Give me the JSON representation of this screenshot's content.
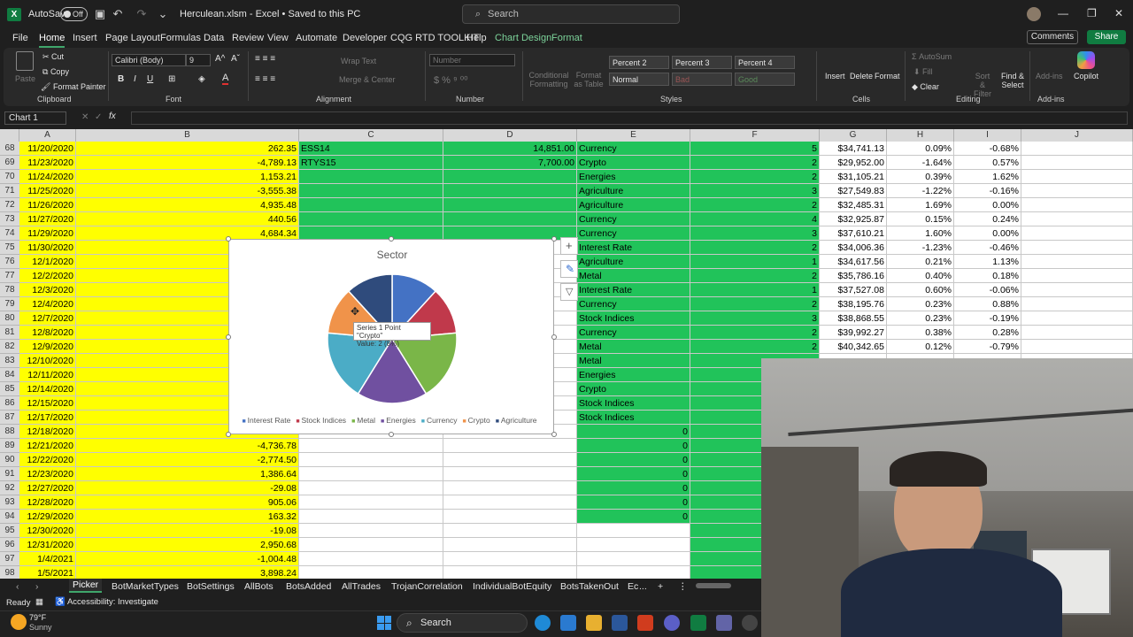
{
  "titlebar": {
    "autosave_label": "AutoSave",
    "autosave_state": "Off",
    "file_title": "Herculean.xlsm  -  Excel  •  Saved to this PC",
    "search_placeholder": "Search"
  },
  "menu": {
    "items": [
      "File",
      "Home",
      "Insert",
      "Page Layout",
      "Formulas",
      "Data",
      "Review",
      "View",
      "Automate",
      "Developer",
      "CQG RTD TOOLKIT",
      "Help",
      "Chart Design",
      "Format"
    ],
    "comments": "Comments",
    "share": "Share"
  },
  "ribbon": {
    "paste": "Paste",
    "cut": "Cut",
    "copy": "Copy",
    "format_painter": "Format Painter",
    "clipboard": "Clipboard",
    "font_name": "Calibri (Body)",
    "font_size": "9",
    "font_group": "Font",
    "wrap_text": "Wrap Text",
    "merge_center": "Merge & Center",
    "alignment": "Alignment",
    "number_format": "Number",
    "number_group": "Number",
    "conditional": "Conditional Formatting",
    "format_as_table": "Format as Table",
    "styles": [
      "Percent 2",
      "Percent 3",
      "Percent 4",
      "Normal",
      "Bad",
      "Good"
    ],
    "styles_group": "Styles",
    "insert": "Insert",
    "delete": "Delete",
    "format": "Format",
    "cells": "Cells",
    "autosum": "AutoSum",
    "fill": "Fill",
    "clear": "Clear",
    "sort_filter": "Sort & Filter",
    "find_select": "Find & Select",
    "editing": "Editing",
    "addins": "Add-ins",
    "addins_group": "Add-ins",
    "copilot": "Copilot"
  },
  "formula_bar": {
    "name_box": "Chart 1",
    "fx": "fx",
    "content": ""
  },
  "columns": [
    "A",
    "B",
    "C",
    "D",
    "E",
    "F",
    "G",
    "H",
    "I",
    "J"
  ],
  "rows": [
    {
      "n": "68",
      "a": "11/20/2020",
      "b": "262.35",
      "c": "ESS14",
      "d": "14,851.00",
      "e": "Currency",
      "f": "5",
      "g": "$34,741.13",
      "h": "0.09%",
      "i": "-0.68%"
    },
    {
      "n": "69",
      "a": "11/23/2020",
      "b": "-4,789.13",
      "c": "RTYS15",
      "d": "7,700.00",
      "e": "Crypto",
      "f": "2",
      "g": "$29,952.00",
      "h": "-1.64%",
      "i": "0.57%"
    },
    {
      "n": "70",
      "a": "11/24/2020",
      "b": "1,153.21",
      "c": "",
      "d": "",
      "e": "Energies",
      "f": "2",
      "g": "$31,105.21",
      "h": "0.39%",
      "i": "1.62%"
    },
    {
      "n": "71",
      "a": "11/25/2020",
      "b": "-3,555.38",
      "c": "",
      "d": "",
      "e": "Agriculture",
      "f": "3",
      "g": "$27,549.83",
      "h": "-1.22%",
      "i": "-0.16%"
    },
    {
      "n": "72",
      "a": "11/26/2020",
      "b": "4,935.48",
      "c": "",
      "d": "",
      "e": "Agriculture",
      "f": "2",
      "g": "$32,485.31",
      "h": "1.69%",
      "i": "0.00%"
    },
    {
      "n": "73",
      "a": "11/27/2020",
      "b": "440.56",
      "c": "",
      "d": "",
      "e": "Currency",
      "f": "4",
      "g": "$32,925.87",
      "h": "0.15%",
      "i": "0.24%"
    },
    {
      "n": "74",
      "a": "11/29/2020",
      "b": "4,684.34",
      "c": "",
      "d": "",
      "e": "Currency",
      "f": "3",
      "g": "$37,610.21",
      "h": "1.60%",
      "i": "0.00%"
    },
    {
      "n": "75",
      "a": "11/30/2020",
      "b": "",
      "c": "",
      "d": "",
      "e": "Interest Rate",
      "f": "2",
      "g": "$34,006.36",
      "h": "-1.23%",
      "i": "-0.46%"
    },
    {
      "n": "76",
      "a": "12/1/2020",
      "b": "",
      "c": "",
      "d": "",
      "e": "Agriculture",
      "f": "1",
      "g": "$34,617.56",
      "h": "0.21%",
      "i": "1.13%"
    },
    {
      "n": "77",
      "a": "12/2/2020",
      "b": "",
      "c": "",
      "d": "",
      "e": "Metal",
      "f": "2",
      "g": "$35,786.16",
      "h": "0.40%",
      "i": "0.18%"
    },
    {
      "n": "78",
      "a": "12/3/2020",
      "b": "",
      "c": "",
      "d": "",
      "e": "Interest Rate",
      "f": "1",
      "g": "$37,527.08",
      "h": "0.60%",
      "i": "-0.06%"
    },
    {
      "n": "79",
      "a": "12/4/2020",
      "b": "",
      "c": "",
      "d": "",
      "e": "Currency",
      "f": "2",
      "g": "$38,195.76",
      "h": "0.23%",
      "i": "0.88%"
    },
    {
      "n": "80",
      "a": "12/7/2020",
      "b": "",
      "c": "",
      "d": "",
      "e": "Stock Indices",
      "f": "3",
      "g": "$38,868.55",
      "h": "0.23%",
      "i": "-0.19%"
    },
    {
      "n": "81",
      "a": "12/8/2020",
      "b": "",
      "c": "",
      "d": "",
      "e": "Currency",
      "f": "2",
      "g": "$39,992.27",
      "h": "0.38%",
      "i": "0.28%"
    },
    {
      "n": "82",
      "a": "12/9/2020",
      "b": "",
      "c": "",
      "d": "",
      "e": "Metal",
      "f": "2",
      "g": "$40,342.65",
      "h": "0.12%",
      "i": "-0.79%"
    },
    {
      "n": "83",
      "a": "12/10/2020",
      "b": "",
      "c": "",
      "d": "",
      "e": "Metal",
      "f": "",
      "g": "",
      "h": "",
      "i": ""
    },
    {
      "n": "84",
      "a": "12/11/2020",
      "b": "",
      "c": "",
      "d": "",
      "e": "Energies",
      "f": "",
      "g": "",
      "h": "",
      "i": ""
    },
    {
      "n": "85",
      "a": "12/14/2020",
      "b": "",
      "c": "",
      "d": "",
      "e": "Crypto",
      "f": "",
      "g": "",
      "h": "",
      "i": ""
    },
    {
      "n": "86",
      "a": "12/15/2020",
      "b": "",
      "c": "",
      "d": "",
      "e": "Stock Indices",
      "f": "",
      "g": "",
      "h": "",
      "i": ""
    },
    {
      "n": "87",
      "a": "12/17/2020",
      "b": "",
      "c": "",
      "d": "",
      "e": "Stock Indices",
      "f": "",
      "g": "",
      "h": "",
      "i": ""
    },
    {
      "n": "88",
      "a": "12/18/2020",
      "b": "",
      "c": "",
      "d": "",
      "e": "0",
      "f": "",
      "g": "",
      "h": "",
      "i": ""
    },
    {
      "n": "89",
      "a": "12/21/2020",
      "b": "-4,736.78",
      "c": "",
      "d": "",
      "e": "0",
      "f": "",
      "g": "",
      "h": "",
      "i": ""
    },
    {
      "n": "90",
      "a": "12/22/2020",
      "b": "-2,774.50",
      "c": "",
      "d": "",
      "e": "0",
      "f": "",
      "g": "",
      "h": "",
      "i": ""
    },
    {
      "n": "91",
      "a": "12/23/2020",
      "b": "1,386.64",
      "c": "",
      "d": "",
      "e": "0",
      "f": "",
      "g": "",
      "h": "",
      "i": ""
    },
    {
      "n": "92",
      "a": "12/27/2020",
      "b": "-29.08",
      "c": "",
      "d": "",
      "e": "0",
      "f": "",
      "g": "",
      "h": "",
      "i": ""
    },
    {
      "n": "93",
      "a": "12/28/2020",
      "b": "905.06",
      "c": "",
      "d": "",
      "e": "0",
      "f": "",
      "g": "",
      "h": "",
      "i": ""
    },
    {
      "n": "94",
      "a": "12/29/2020",
      "b": "163.32",
      "c": "",
      "d": "",
      "e": "0",
      "f": "",
      "g": "",
      "h": "",
      "i": ""
    },
    {
      "n": "95",
      "a": "12/30/2020",
      "b": "-19.08",
      "c": "",
      "d": "",
      "e": "",
      "f": "",
      "g": "",
      "h": "",
      "i": ""
    },
    {
      "n": "96",
      "a": "12/31/2020",
      "b": "2,950.68",
      "c": "",
      "d": "",
      "e": "",
      "f": "",
      "g": "",
      "h": "",
      "i": ""
    },
    {
      "n": "97",
      "a": "1/4/2021",
      "b": "-1,004.48",
      "c": "",
      "d": "",
      "e": "",
      "f": "",
      "g": "",
      "h": "",
      "i": ""
    },
    {
      "n": "98",
      "a": "1/5/2021",
      "b": "3,898.24",
      "c": "",
      "d": "",
      "e": "",
      "f": "",
      "g": "",
      "h": "",
      "i": ""
    }
  ],
  "chart_data": {
    "type": "pie",
    "title": "Sector",
    "series": [
      {
        "name": "Series 1",
        "values": [
          2,
          2,
          3,
          3,
          3,
          2,
          2
        ]
      }
    ],
    "categories": [
      "Interest Rate",
      "Stock Indices",
      "Metal",
      "Energies",
      "Currency",
      "Crypto",
      "Agriculture"
    ],
    "colors": [
      "#4472c4",
      "#c0394b",
      "#7ab648",
      "#7050a0",
      "#4bacc6",
      "#f0934a",
      "#2f4b7c"
    ],
    "legend": "bottom",
    "tooltip_line1": "Series 1 Point \"Crypto\"",
    "tooltip_line2": "Value: 2 (8%)"
  },
  "sheets": {
    "tabs": [
      "Picker",
      "BotMarketTypes",
      "BotSettings",
      "AllBots",
      "BotsAdded",
      "AllTrades",
      "TrojanCorrelation",
      "IndividualBotEquity",
      "BotsTakenOut",
      "Ec"
    ],
    "active": "Picker",
    "more": "..."
  },
  "status": {
    "ready": "Ready",
    "accessibility": "Accessibility: Investigate"
  },
  "taskbar": {
    "temp": "79°F",
    "weather": "Sunny",
    "search": "Search"
  }
}
